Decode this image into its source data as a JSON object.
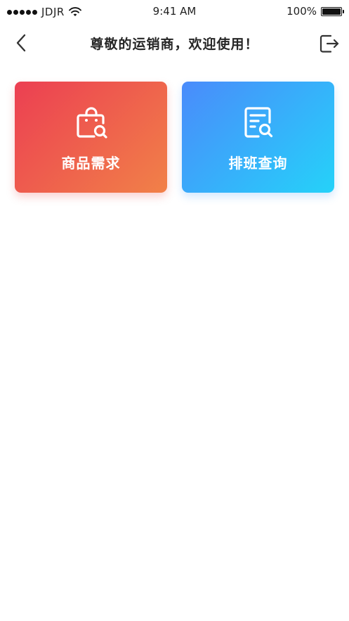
{
  "status_bar": {
    "carrier": "JDJR",
    "time": "9:41 AM",
    "battery": "100%",
    "icons": [
      "signal-dots-icon",
      "wifi-icon",
      "battery-icon"
    ]
  },
  "nav": {
    "title": "尊敬的运销商，欢迎使用！",
    "back_icon": "chevron-left-icon",
    "logout_icon": "logout-icon"
  },
  "cards": [
    {
      "label": "商品需求",
      "icon": "shopping-bag-search-icon",
      "gradient": [
        "#ec3f52",
        "#f18148"
      ]
    },
    {
      "label": "排班查询",
      "icon": "document-search-icon",
      "gradient": [
        "#4a8bfb",
        "#25d2f9"
      ]
    }
  ]
}
